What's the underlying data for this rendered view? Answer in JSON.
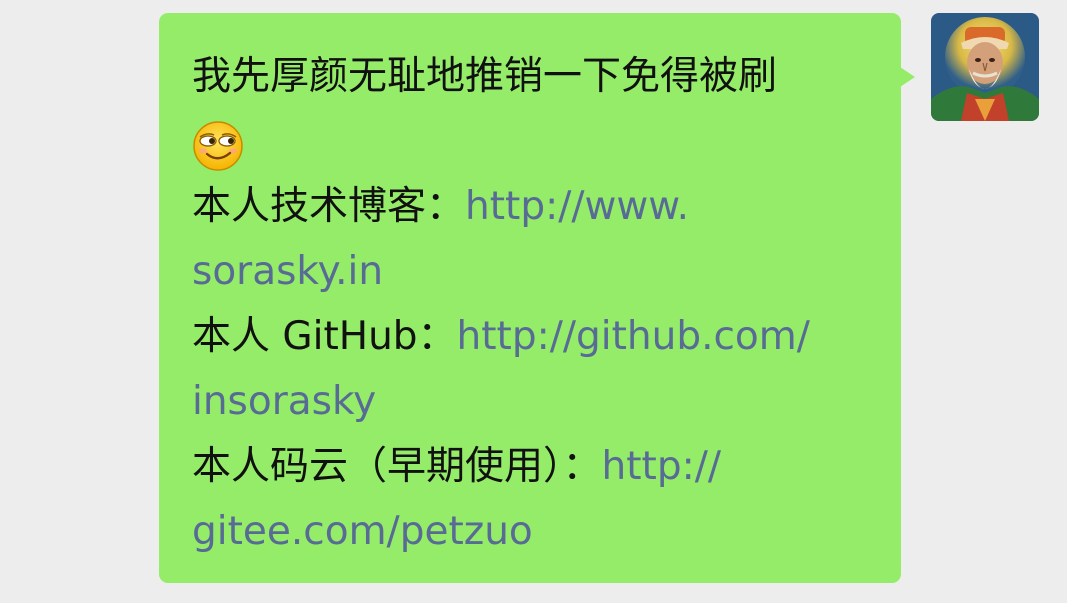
{
  "message": {
    "line1": "我先厚颜无耻地推销一下免得被刷",
    "emoji": "smirk-emoji",
    "blog_label": "本人技术博客：",
    "blog_url_part1": "http://www.",
    "blog_url_part2": "sorasky.in",
    "github_label": "本人 GitHub：",
    "github_url_part1": "http://github.com/",
    "github_url_part2": "insorasky",
    "gitee_label": "本人码云（早期使用）：",
    "gitee_url_part1": "http://",
    "gitee_url_part2": "gitee.com/petzuo"
  },
  "colors": {
    "bubble": "#95ec69",
    "background": "#ededed",
    "text": "#111111",
    "link": "#576b95"
  },
  "avatar": {
    "icon": "user-avatar"
  }
}
